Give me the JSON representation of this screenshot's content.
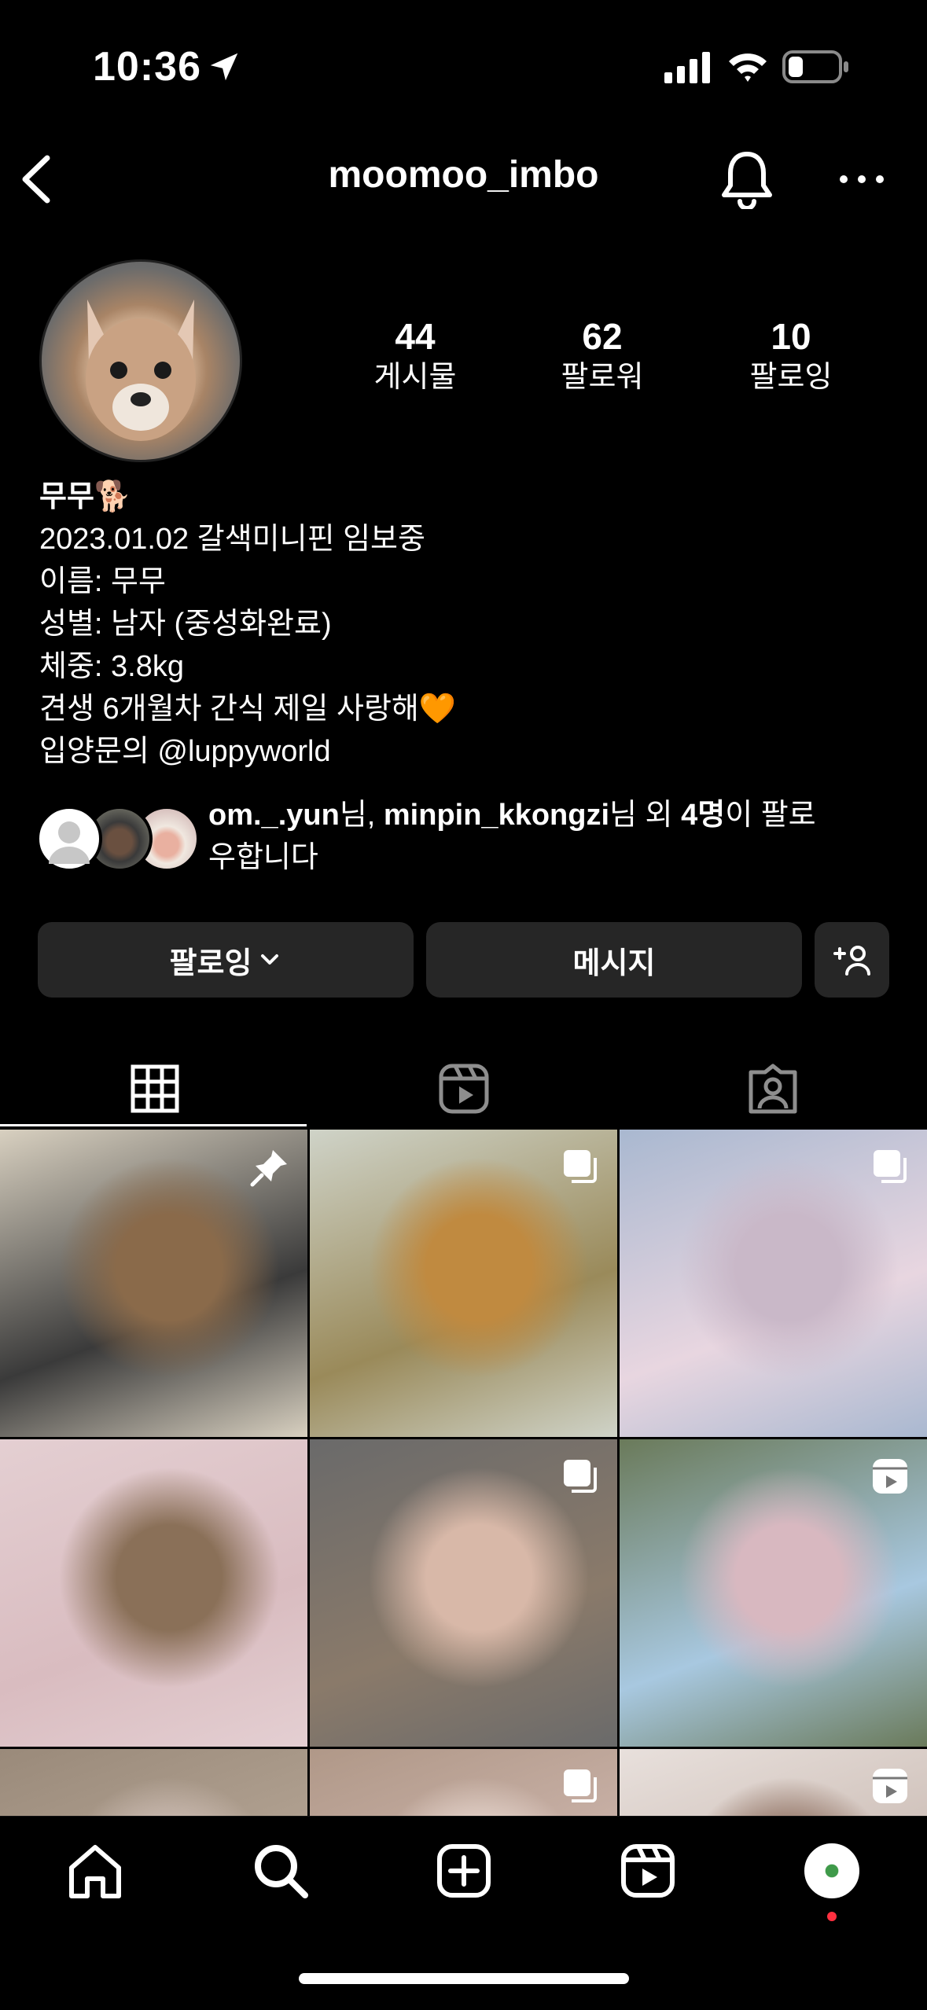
{
  "status_bar": {
    "time": "10:36"
  },
  "header": {
    "username": "moomoo_imbo"
  },
  "stats": [
    {
      "value": "44",
      "label": "게시물"
    },
    {
      "value": "62",
      "label": "팔로워"
    },
    {
      "value": "10",
      "label": "팔로잉"
    }
  ],
  "bio": {
    "name": "무무🐕",
    "lines": [
      "2023.01.02 갈색미니핀 임보중",
      "이름: 무무",
      "성별: 남자 (중성화완료)",
      "체중: 3.8kg",
      "견생 6개월차 간식 제일 사랑해🧡",
      "입양문의 @luppyworld"
    ]
  },
  "followed_by": {
    "user1": "om._.yun",
    "sep1": "님, ",
    "user2": "minpin_kkongzi",
    "sep2": "님 외 ",
    "count": "4명",
    "suffix_line1": "이 팔로",
    "suffix_line2": "우합니다"
  },
  "buttons": {
    "following": "팔로잉",
    "message": "메시지"
  },
  "tabs": [
    "grid-tab",
    "reels-tab",
    "tagged-tab"
  ],
  "grid": [
    {
      "badge": "pin-icon",
      "colors": [
        "#3a3a3a",
        "#8a6a4a",
        "#d8d0c0"
      ]
    },
    {
      "badge": "carousel-icon",
      "colors": [
        "#9a8a5a",
        "#c08a40",
        "#cfd3c8"
      ]
    },
    {
      "badge": "carousel-icon",
      "colors": [
        "#e8d6e0",
        "#c9b8c8",
        "#a9b8d0"
      ]
    },
    {
      "badge": "",
      "colors": [
        "#d9bcc0",
        "#8a7058",
        "#e4cfd2"
      ]
    },
    {
      "badge": "carousel-icon",
      "colors": [
        "#8a7a6a",
        "#d8b8a8",
        "#6a6a6a"
      ]
    },
    {
      "badge": "reel-icon",
      "colors": [
        "#a8c8e0",
        "#d8b8c0",
        "#6a7a5a"
      ]
    },
    {
      "badge": "",
      "colors": [
        "#b8a898",
        "#d0c0b8",
        "#9a8a7a"
      ]
    },
    {
      "badge": "carousel-icon",
      "colors": [
        "#d0b8b0",
        "#e8d8d0",
        "#b09888"
      ]
    },
    {
      "badge": "reel-icon",
      "colors": [
        "#c8b8b0",
        "#8a6a5a",
        "#e8e0dc"
      ]
    }
  ],
  "nav": [
    "home-icon",
    "search-icon",
    "create-icon",
    "reels-icon",
    "profile-avatar"
  ],
  "colors": {
    "notification_dot": "#ff3040",
    "button_bg": "#262626"
  }
}
